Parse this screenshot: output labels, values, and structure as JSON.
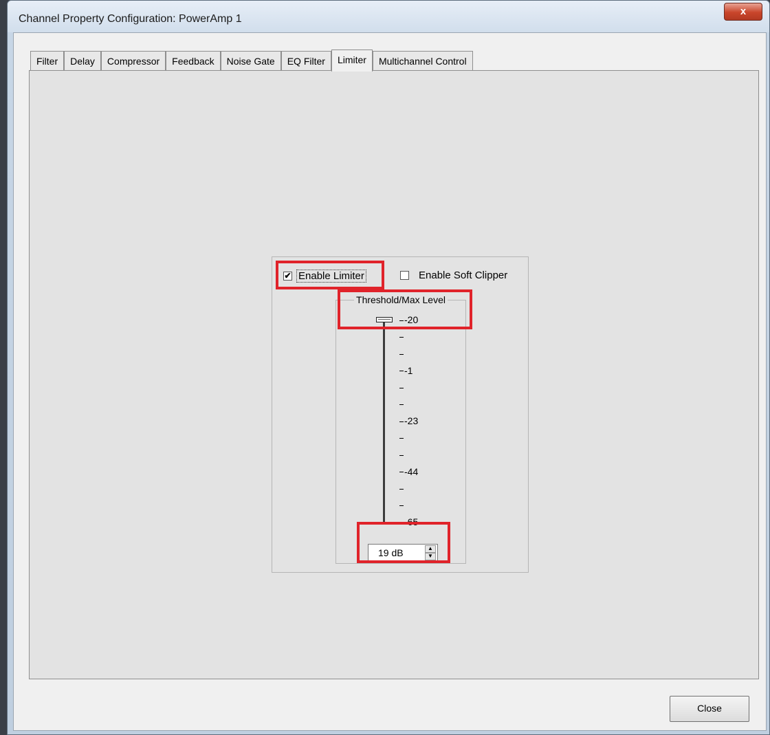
{
  "window": {
    "title": "Channel Property Configuration: PowerAmp 1",
    "close_glyph": "x"
  },
  "tabs": [
    {
      "label": "Filter",
      "active": false
    },
    {
      "label": "Delay",
      "active": false
    },
    {
      "label": "Compressor",
      "active": false
    },
    {
      "label": "Feedback",
      "active": false
    },
    {
      "label": "Noise Gate",
      "active": false
    },
    {
      "label": "EQ Filter",
      "active": false
    },
    {
      "label": "Limiter",
      "active": true
    },
    {
      "label": "Multichannel Control",
      "active": false
    }
  ],
  "limiter": {
    "enable_limiter": {
      "label": "Enable Limiter",
      "checked": true
    },
    "enable_soft_clipper": {
      "label": "Enable Soft Clipper",
      "checked": false
    },
    "threshold_group_title": "Threshold/Max Level",
    "scale_labels": [
      "-20",
      "",
      "",
      "-1",
      "",
      "",
      "-23",
      "",
      "",
      "-44",
      "",
      "",
      "-65"
    ],
    "spin_value": "19 dB",
    "slider_position": 0
  },
  "footer": {
    "close_label": "Close"
  },
  "colors": {
    "highlight": "#e0232a",
    "panel": "#e3e3e3"
  }
}
